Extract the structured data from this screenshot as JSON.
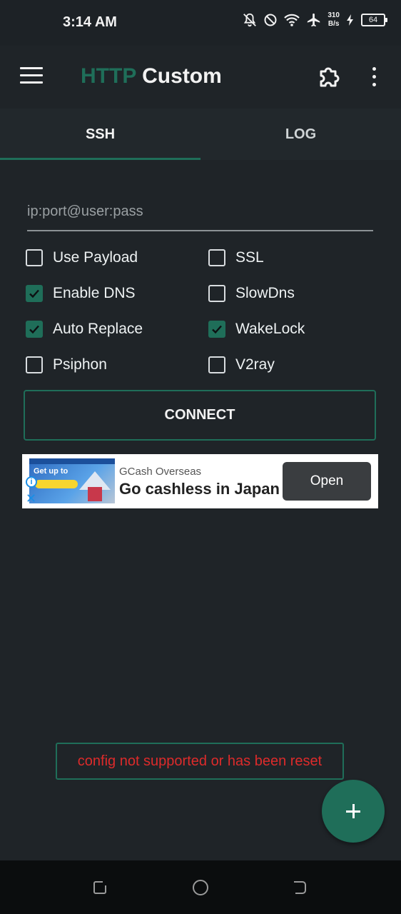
{
  "status_bar": {
    "time": "3:14 AM",
    "net_speed_value": "310",
    "net_speed_unit": "B/s",
    "battery": "64",
    "icons": [
      "bell-off-icon",
      "do-not-disturb-icon",
      "wifi-icon",
      "airplane-mode-icon",
      "charging-icon",
      "battery-icon"
    ]
  },
  "app_bar": {
    "title_part1": "HTTP",
    "title_part2": "Custom",
    "title_accent_color": "#1f6e59",
    "icons": [
      "menu-icon",
      "puzzle-icon",
      "more-vert-icon"
    ]
  },
  "tabs": [
    {
      "label": "SSH",
      "selected": true
    },
    {
      "label": "LOG",
      "selected": false
    }
  ],
  "form": {
    "host_placeholder": "ip:port@user:pass",
    "host_value": "",
    "options": {
      "use_payload": {
        "label": "Use Payload",
        "checked": false
      },
      "ssl": {
        "label": "SSL",
        "checked": false
      },
      "enable_dns": {
        "label": "Enable DNS",
        "checked": true
      },
      "slowdns": {
        "label": "SlowDns",
        "checked": false
      },
      "auto_replace": {
        "label": "Auto Replace",
        "checked": true
      },
      "wakelock": {
        "label": "WakeLock",
        "checked": true
      },
      "psiphon": {
        "label": "Psiphon",
        "checked": false
      },
      "v2ray": {
        "label": "V2ray",
        "checked": false
      }
    },
    "connect_label": "CONNECT"
  },
  "ad": {
    "image_text": "Get up to",
    "sponsor": "GCash Overseas",
    "headline": "Go cashless in Japan",
    "cta": "Open"
  },
  "toast": {
    "message": "config not supported or has been reset",
    "color": "#dd2b2b"
  },
  "fab": {
    "icon": "plus-icon",
    "color": "#1f6e59"
  },
  "nav_bar": {
    "icons": [
      "recents-icon",
      "home-icon",
      "back-icon"
    ]
  }
}
